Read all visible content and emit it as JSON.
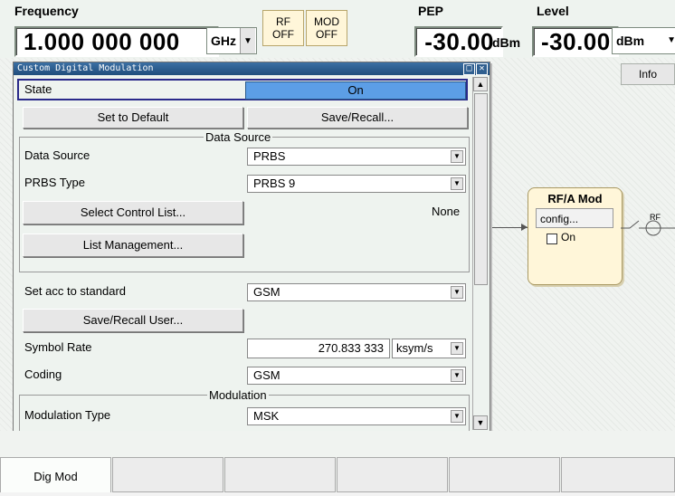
{
  "topbar": {
    "frequency_label": "Frequency",
    "frequency_value": "1.000 000 000 00",
    "frequency_unit": "GHz",
    "rf_button": {
      "line1": "RF",
      "line2": "OFF"
    },
    "mod_button": {
      "line1": "MOD",
      "line2": "OFF"
    },
    "pep_label": "PEP",
    "pep_value": "-30.00",
    "pep_unit": "dBm",
    "level_label": "Level",
    "level_value": "-30.00",
    "level_unit": "dBm"
  },
  "diagram": {
    "info_button": "Info",
    "rfmod": {
      "title": "RF/A Mod",
      "config_button": "config...",
      "checkbox_label": "On"
    },
    "rf_output_label": "RF"
  },
  "dialog": {
    "title": "Custom Digital Modulation",
    "state": {
      "label": "State",
      "value": "On"
    },
    "set_to_default": "Set to Default",
    "save_recall": "Save/Recall...",
    "data_source_group": "Data Source",
    "data_source": {
      "label": "Data Source",
      "value": "PRBS"
    },
    "prbs_type": {
      "label": "PRBS Type",
      "value": "PRBS 9"
    },
    "select_control_list": "Select Control List...",
    "control_list_value": "None",
    "list_management": "List Management...",
    "set_acc_standard": {
      "label": "Set acc to standard",
      "value": "GSM"
    },
    "save_recall_user": "Save/Recall User...",
    "symbol_rate": {
      "label": "Symbol Rate",
      "value": "270.833 333",
      "unit": "ksym/s"
    },
    "coding": {
      "label": "Coding",
      "value": "GSM"
    },
    "modulation_group": "Modulation",
    "modulation_type": {
      "label": "Modulation Type",
      "value": "MSK"
    }
  },
  "tabs": [
    {
      "label": "Dig Mod",
      "active": true
    },
    {
      "label": ""
    },
    {
      "label": ""
    },
    {
      "label": ""
    },
    {
      "label": ""
    },
    {
      "label": ""
    }
  ]
}
